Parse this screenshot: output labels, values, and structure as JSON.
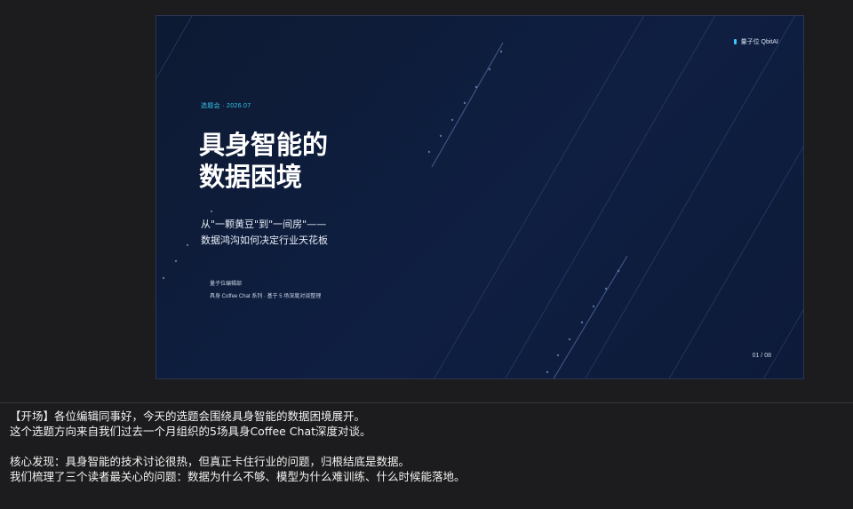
{
  "slide": {
    "brand": "量子位 QbitAI",
    "eyebrow": "选题会 · 2026.07",
    "title_line1": "具身智能的",
    "title_line2": "数据困境",
    "subtitle_line1": "从\"一颗黄豆\"到\"一间房\"——",
    "subtitle_line2": "数据鸿沟如何决定行业天花板",
    "meta_line1": "量子位编辑部",
    "meta_line2": "具身 Coffee Chat 系列 · 基于 5 场深度对谈整理",
    "page_number": "01 / 08"
  },
  "notes": {
    "line1": "【开场】各位编辑同事好，今天的选题会围绕具身智能的数据困境展开。",
    "line2": "这个选题方向来自我们过去一个月组织的5场具身Coffee Chat深度对谈。",
    "line3": "核心发现：具身智能的技术讨论很热，但真正卡住行业的问题，归根结底是数据。",
    "line4": "我们梳理了三个读者最关心的问题：数据为什么不够、模型为什么难训练、什么时候能落地。"
  },
  "colors": {
    "slide_bg": "#0f1f42",
    "accent": "#34c6ea",
    "page_bg": "#1c1c1e"
  }
}
